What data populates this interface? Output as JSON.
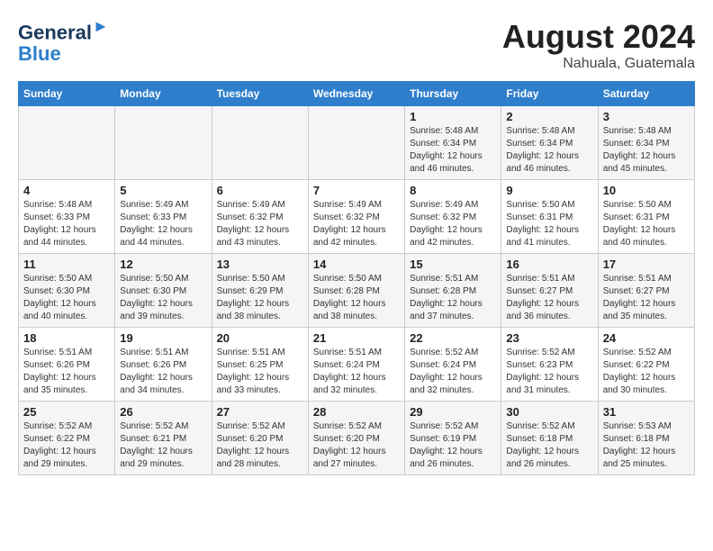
{
  "logo": {
    "line1": "General",
    "line2": "Blue"
  },
  "title": "August 2024",
  "location": "Nahuala, Guatemala",
  "weekdays": [
    "Sunday",
    "Monday",
    "Tuesday",
    "Wednesday",
    "Thursday",
    "Friday",
    "Saturday"
  ],
  "weeks": [
    [
      {
        "day": "",
        "detail": ""
      },
      {
        "day": "",
        "detail": ""
      },
      {
        "day": "",
        "detail": ""
      },
      {
        "day": "",
        "detail": ""
      },
      {
        "day": "1",
        "detail": "Sunrise: 5:48 AM\nSunset: 6:34 PM\nDaylight: 12 hours\nand 46 minutes."
      },
      {
        "day": "2",
        "detail": "Sunrise: 5:48 AM\nSunset: 6:34 PM\nDaylight: 12 hours\nand 46 minutes."
      },
      {
        "day": "3",
        "detail": "Sunrise: 5:48 AM\nSunset: 6:34 PM\nDaylight: 12 hours\nand 45 minutes."
      }
    ],
    [
      {
        "day": "4",
        "detail": "Sunrise: 5:48 AM\nSunset: 6:33 PM\nDaylight: 12 hours\nand 44 minutes."
      },
      {
        "day": "5",
        "detail": "Sunrise: 5:49 AM\nSunset: 6:33 PM\nDaylight: 12 hours\nand 44 minutes."
      },
      {
        "day": "6",
        "detail": "Sunrise: 5:49 AM\nSunset: 6:32 PM\nDaylight: 12 hours\nand 43 minutes."
      },
      {
        "day": "7",
        "detail": "Sunrise: 5:49 AM\nSunset: 6:32 PM\nDaylight: 12 hours\nand 42 minutes."
      },
      {
        "day": "8",
        "detail": "Sunrise: 5:49 AM\nSunset: 6:32 PM\nDaylight: 12 hours\nand 42 minutes."
      },
      {
        "day": "9",
        "detail": "Sunrise: 5:50 AM\nSunset: 6:31 PM\nDaylight: 12 hours\nand 41 minutes."
      },
      {
        "day": "10",
        "detail": "Sunrise: 5:50 AM\nSunset: 6:31 PM\nDaylight: 12 hours\nand 40 minutes."
      }
    ],
    [
      {
        "day": "11",
        "detail": "Sunrise: 5:50 AM\nSunset: 6:30 PM\nDaylight: 12 hours\nand 40 minutes."
      },
      {
        "day": "12",
        "detail": "Sunrise: 5:50 AM\nSunset: 6:30 PM\nDaylight: 12 hours\nand 39 minutes."
      },
      {
        "day": "13",
        "detail": "Sunrise: 5:50 AM\nSunset: 6:29 PM\nDaylight: 12 hours\nand 38 minutes."
      },
      {
        "day": "14",
        "detail": "Sunrise: 5:50 AM\nSunset: 6:28 PM\nDaylight: 12 hours\nand 38 minutes."
      },
      {
        "day": "15",
        "detail": "Sunrise: 5:51 AM\nSunset: 6:28 PM\nDaylight: 12 hours\nand 37 minutes."
      },
      {
        "day": "16",
        "detail": "Sunrise: 5:51 AM\nSunset: 6:27 PM\nDaylight: 12 hours\nand 36 minutes."
      },
      {
        "day": "17",
        "detail": "Sunrise: 5:51 AM\nSunset: 6:27 PM\nDaylight: 12 hours\nand 35 minutes."
      }
    ],
    [
      {
        "day": "18",
        "detail": "Sunrise: 5:51 AM\nSunset: 6:26 PM\nDaylight: 12 hours\nand 35 minutes."
      },
      {
        "day": "19",
        "detail": "Sunrise: 5:51 AM\nSunset: 6:26 PM\nDaylight: 12 hours\nand 34 minutes."
      },
      {
        "day": "20",
        "detail": "Sunrise: 5:51 AM\nSunset: 6:25 PM\nDaylight: 12 hours\nand 33 minutes."
      },
      {
        "day": "21",
        "detail": "Sunrise: 5:51 AM\nSunset: 6:24 PM\nDaylight: 12 hours\nand 32 minutes."
      },
      {
        "day": "22",
        "detail": "Sunrise: 5:52 AM\nSunset: 6:24 PM\nDaylight: 12 hours\nand 32 minutes."
      },
      {
        "day": "23",
        "detail": "Sunrise: 5:52 AM\nSunset: 6:23 PM\nDaylight: 12 hours\nand 31 minutes."
      },
      {
        "day": "24",
        "detail": "Sunrise: 5:52 AM\nSunset: 6:22 PM\nDaylight: 12 hours\nand 30 minutes."
      }
    ],
    [
      {
        "day": "25",
        "detail": "Sunrise: 5:52 AM\nSunset: 6:22 PM\nDaylight: 12 hours\nand 29 minutes."
      },
      {
        "day": "26",
        "detail": "Sunrise: 5:52 AM\nSunset: 6:21 PM\nDaylight: 12 hours\nand 29 minutes."
      },
      {
        "day": "27",
        "detail": "Sunrise: 5:52 AM\nSunset: 6:20 PM\nDaylight: 12 hours\nand 28 minutes."
      },
      {
        "day": "28",
        "detail": "Sunrise: 5:52 AM\nSunset: 6:20 PM\nDaylight: 12 hours\nand 27 minutes."
      },
      {
        "day": "29",
        "detail": "Sunrise: 5:52 AM\nSunset: 6:19 PM\nDaylight: 12 hours\nand 26 minutes."
      },
      {
        "day": "30",
        "detail": "Sunrise: 5:52 AM\nSunset: 6:18 PM\nDaylight: 12 hours\nand 26 minutes."
      },
      {
        "day": "31",
        "detail": "Sunrise: 5:53 AM\nSunset: 6:18 PM\nDaylight: 12 hours\nand 25 minutes."
      }
    ]
  ]
}
